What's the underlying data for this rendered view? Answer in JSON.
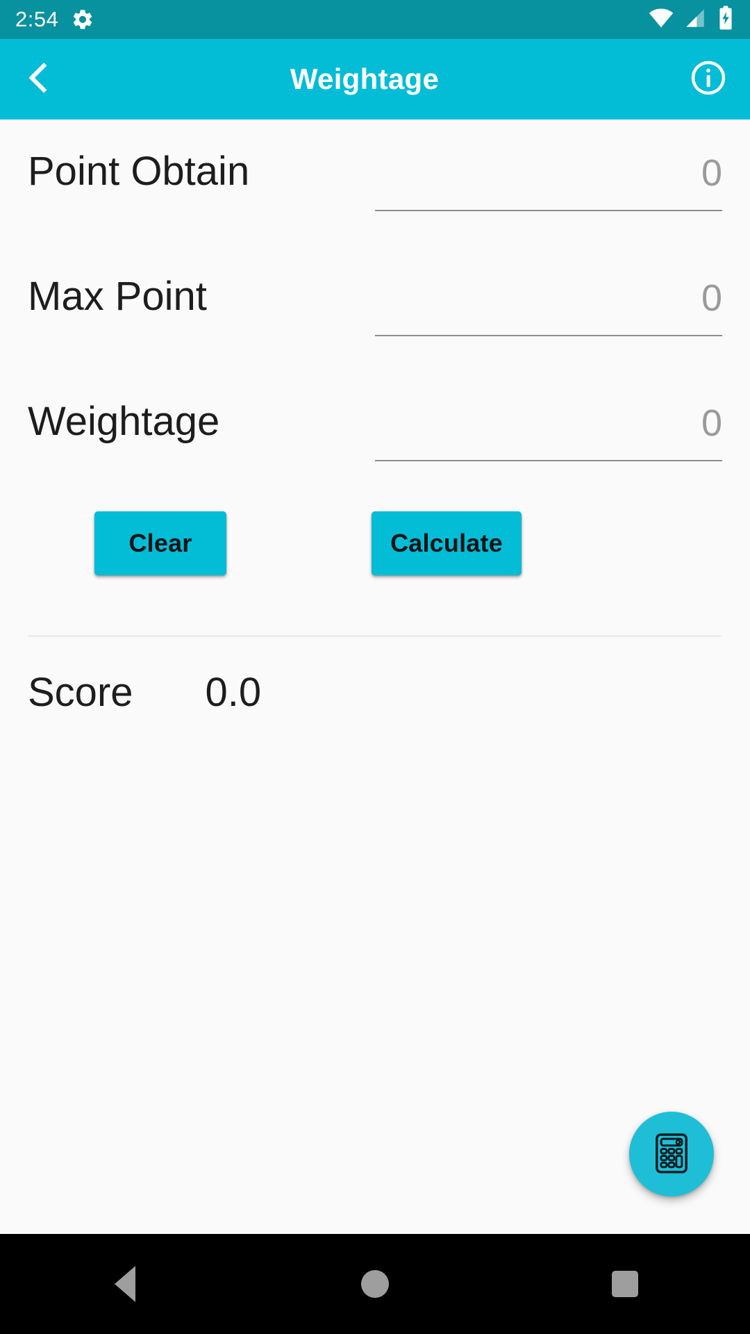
{
  "status_bar": {
    "clock": "2:54",
    "gear_icon": "gear-icon",
    "wifi_icon": "wifi-icon",
    "signal_icon": "cellular-signal-icon",
    "battery_icon": "battery-charging-icon",
    "background_color": "#08919f"
  },
  "app_bar": {
    "back_icon": "chevron-left-icon",
    "title": "Weightage",
    "info_icon": "info-circle-icon",
    "background_color": "#03bcd6",
    "text_color": "#ffffff"
  },
  "form": {
    "fields": [
      {
        "label": "Point Obtain",
        "value": "",
        "placeholder": "0"
      },
      {
        "label": "Max Point",
        "value": "",
        "placeholder": "0"
      },
      {
        "label": "Weightage",
        "value": "",
        "placeholder": "0"
      }
    ]
  },
  "actions": {
    "clear_label": "Clear",
    "calculate_label": "Calculate",
    "button_color": "#03bcd6",
    "button_text_color": "#0a1316"
  },
  "result": {
    "label": "Score",
    "value": "0.0"
  },
  "fab": {
    "icon": "calculator-icon",
    "color": "#1ebfd6"
  },
  "nav_bar": {
    "back_icon": "triangle-back-icon",
    "home_icon": "circle-home-icon",
    "recents_icon": "square-recents-icon",
    "background_color": "#000000",
    "icon_color": "#9e9e9e"
  }
}
